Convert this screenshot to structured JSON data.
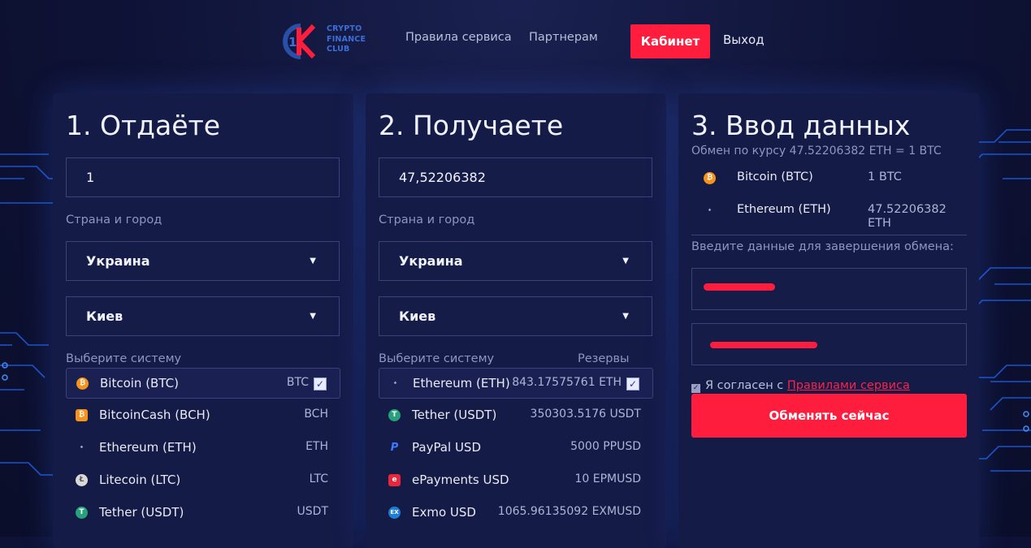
{
  "header": {
    "logo_lines": [
      "CRYPTO",
      "FINANCE",
      "CLUB"
    ],
    "nav": [
      "Правила сервиса",
      "Партнерам"
    ],
    "cabinet_label": "Кабинет",
    "exit_label": "Выход"
  },
  "give": {
    "title": "1. Отдаёте",
    "amount": "1",
    "location_label": "Страна и город",
    "country": "Украина",
    "city": "Киев",
    "system_label": "Выберите систему",
    "systems": [
      {
        "name": "Bitcoin (BTC)",
        "code": "BTC",
        "icon": "bitcoin-icon",
        "color": "#f7931a",
        "selected": true
      },
      {
        "name": "BitcoinCash (BCH)",
        "code": "BCH",
        "icon": "bitcoincash-icon",
        "color": "#f7931a",
        "selected": false
      },
      {
        "name": "Ethereum (ETH)",
        "code": "ETH",
        "icon": "ethereum-icon",
        "color": "#8a93b2",
        "selected": false
      },
      {
        "name": "Litecoin (LTC)",
        "code": "LTC",
        "icon": "litecoin-icon",
        "color": "#d9d9d9",
        "selected": false
      },
      {
        "name": "Tether (USDT)",
        "code": "USDT",
        "icon": "tether-icon",
        "color": "#26a17b",
        "selected": false
      }
    ]
  },
  "receive": {
    "title": "2. Получаете",
    "amount": "47,52206382",
    "location_label": "Страна и город",
    "country": "Украина",
    "city": "Киев",
    "system_label": "Выберите систему",
    "reserves_label": "Резервы",
    "systems": [
      {
        "name": "Ethereum (ETH)",
        "code": "843.17575761 ETH",
        "icon": "ethereum-icon",
        "color": "#8a93b2",
        "selected": true
      },
      {
        "name": "Tether (USDT)",
        "code": "350303.5176 USDT",
        "icon": "tether-icon",
        "color": "#26a17b",
        "selected": false
      },
      {
        "name": "PayPal USD",
        "code": "5000 PPUSD",
        "icon": "paypal-icon",
        "color": "#253b80",
        "selected": false
      },
      {
        "name": "ePayments USD",
        "code": "10 EPMUSD",
        "icon": "epayments-icon",
        "color": "#e8263c",
        "selected": false
      },
      {
        "name": "Exmo USD",
        "code": "1065.96135092 EXMUSD",
        "icon": "exmo-icon",
        "color": "#1c7fd6",
        "selected": false
      }
    ]
  },
  "data_entry": {
    "title": "3. Ввод данных",
    "rate": "Обмен по курсу 47.52206382 ETH = 1 BTC",
    "give_name": "Bitcoin (BTC)",
    "give_amount": "1 BTC",
    "receive_name": "Ethereum (ETH)",
    "receive_amount": "47.52206382 ETH",
    "instructions": "Введите данные для завершения обмена:",
    "agree_text": "Я согласен с ",
    "agree_link": "Правилами сервиса",
    "submit_label": "Обменять сейчас"
  },
  "colors": {
    "accent": "#ff1d3e",
    "background": "#0e1235",
    "panel": "#151b47"
  }
}
